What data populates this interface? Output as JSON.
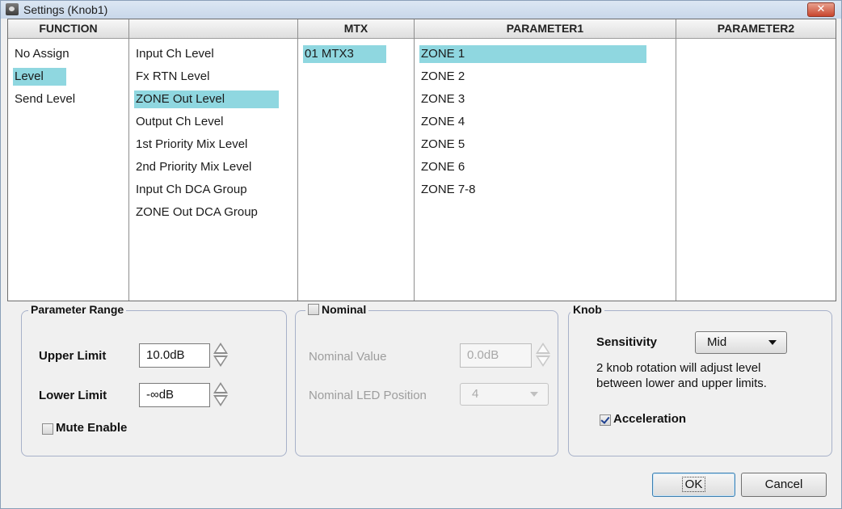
{
  "window": {
    "title": "Settings (Knob1)",
    "close_glyph": "✕"
  },
  "grid": {
    "headers": {
      "function": "FUNCTION",
      "sub": "",
      "mtx": "MTX",
      "param1": "PARAMETER1",
      "param2": "PARAMETER2"
    },
    "function_items": [
      "No Assign",
      "Level",
      "Send Level"
    ],
    "function_selected": "Level",
    "sub_items": [
      "Input Ch Level",
      "Fx RTN Level",
      "ZONE Out Level",
      "Output Ch Level",
      "1st Priority Mix Level",
      "2nd Priority Mix Level",
      "Input Ch DCA Group",
      "ZONE Out DCA Group"
    ],
    "sub_selected": "ZONE Out Level",
    "mtx_items": [
      "01 MTX3"
    ],
    "mtx_selected": "01 MTX3",
    "param1_items": [
      "ZONE 1",
      "ZONE 2",
      "ZONE 3",
      "ZONE 4",
      "ZONE 5",
      "ZONE 6",
      "ZONE 7-8"
    ],
    "param1_selected": "ZONE 1",
    "param2_items": []
  },
  "parameter_range": {
    "legend": "Parameter Range",
    "upper_label": "Upper Limit",
    "upper_value": "10.0dB",
    "lower_label": "Lower Limit",
    "lower_value": "-∞dB",
    "mute_label": "Mute Enable",
    "mute_checked": false
  },
  "nominal": {
    "legend": "Nominal",
    "checked": false,
    "value_label": "Nominal Value",
    "value": "0.0dB",
    "led_label": "Nominal LED Position",
    "led_value": "4"
  },
  "knob": {
    "legend": "Knob",
    "sensitivity_label": "Sensitivity",
    "sensitivity_value": "Mid",
    "desc_line1": "2 knob rotation will adjust level",
    "desc_line2": "between lower and upper limits.",
    "acceleration_label": "Acceleration",
    "acceleration_checked": true
  },
  "buttons": {
    "ok": "OK",
    "cancel": "Cancel"
  },
  "colors": {
    "selection": "#8fd7e0",
    "frame": "#a7b1c9"
  }
}
